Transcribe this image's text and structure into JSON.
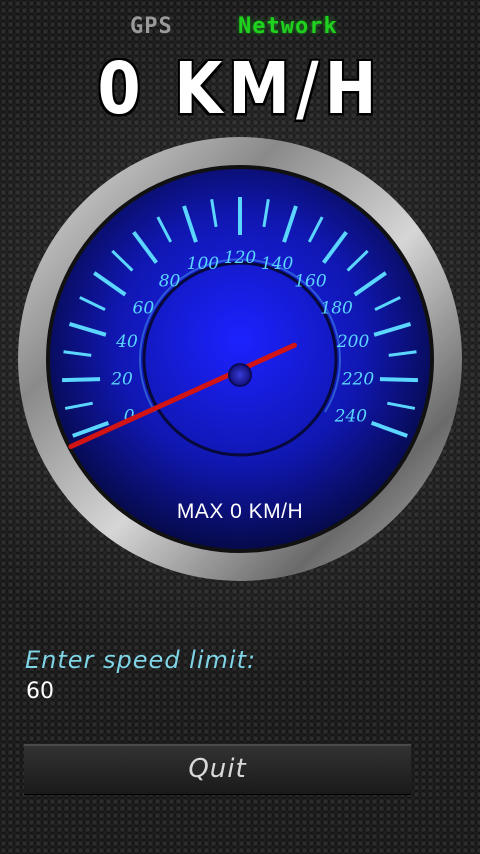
{
  "header": {
    "sources": [
      {
        "label": "GPS",
        "active": false,
        "color": "#9a9a9a"
      },
      {
        "label": "Network",
        "active": true,
        "color": "#1ed21e"
      }
    ],
    "speed_text": "0 KM/H"
  },
  "gauge": {
    "tick_labels": [
      "0",
      "20",
      "40",
      "60",
      "80",
      "100",
      "120",
      "140",
      "160",
      "180",
      "200",
      "220",
      "240"
    ],
    "max_label": "MAX 0 KM/H",
    "accent_color": "#5bd6ff",
    "face_color": "#1418c8",
    "needle_color": "#d21414"
  },
  "speed_limit": {
    "label": "Enter speed limit:",
    "value": "60"
  },
  "quit_label": "Quit"
}
